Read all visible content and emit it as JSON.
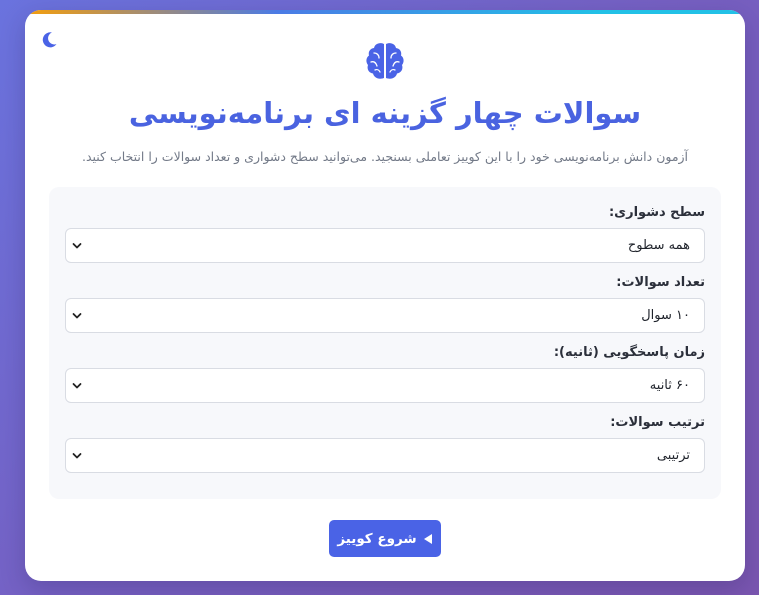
{
  "header": {
    "title": "سوالات چهار گزینه ای برنامه‌نویسی",
    "subtitle": "آزمون دانش برنامه‌نویسی خود را با این کوییز تعاملی بسنجید. می‌توانید سطح دشواری و تعداد سوالات را انتخاب کنید.",
    "logo_icon": "brain-icon",
    "theme_icon": "moon-icon"
  },
  "settings": {
    "difficulty": {
      "label": "سطح دشواری:",
      "value": "همه سطوح"
    },
    "count": {
      "label": "تعداد سوالات:",
      "value": "۱۰ سوال"
    },
    "time": {
      "label": "زمان پاسخگویی (ثانیه):",
      "value": "۶۰ ثانیه"
    },
    "order": {
      "label": "ترتیب سوالات:",
      "value": "ترتیبی"
    }
  },
  "start_button": {
    "label": "شروع کوییز",
    "icon": "play-icon"
  },
  "colors": {
    "accent": "#4a63e6",
    "background_start": "#6a73de",
    "background_end": "#7a56b0"
  }
}
